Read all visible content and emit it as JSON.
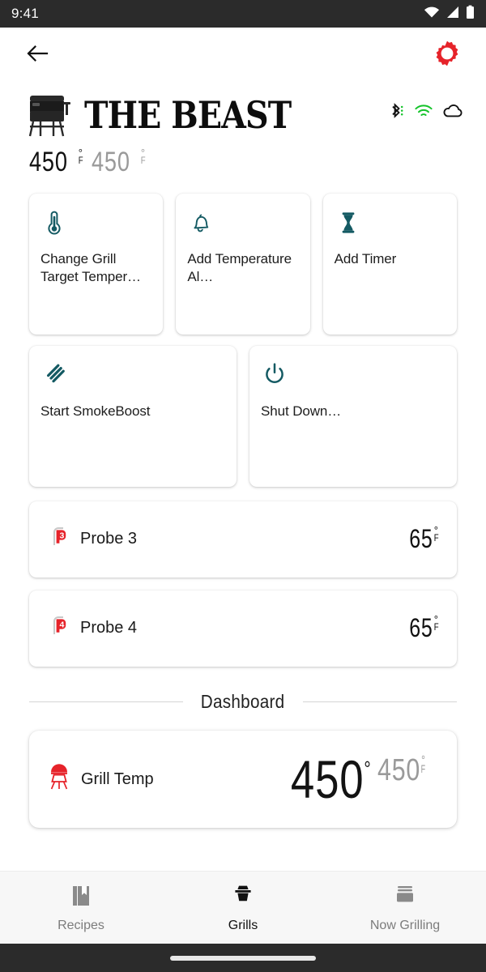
{
  "status_bar": {
    "time": "9:41",
    "icons": [
      "wifi-icon",
      "cellular-signal-icon",
      "battery-icon"
    ]
  },
  "app_bar": {
    "back_icon": "back-arrow-icon",
    "settings_icon": "gear-icon",
    "settings_color": "#e6232a"
  },
  "grill_header": {
    "name": "THE BEAST",
    "grill_image": "pellet-grill-image",
    "connectivity": [
      {
        "name": "bluetooth-icon",
        "color": "#111111"
      },
      {
        "name": "wifi-icon",
        "color": "#14c32a"
      },
      {
        "name": "cloud-icon",
        "color": "#111111"
      }
    ],
    "current_temp": "450",
    "current_unit_deg": "°",
    "current_unit_f": "F",
    "target_temp": "450",
    "target_unit_deg": "°",
    "target_unit_f": "F"
  },
  "action_cards": [
    {
      "icon": "thermometer-icon",
      "label": "Change Grill Target Temper…"
    },
    {
      "icon": "bell-icon",
      "label": "Add Temperature Al…"
    },
    {
      "icon": "hourglass-icon",
      "label": "Add Timer"
    },
    {
      "icon": "smoke-lines-icon",
      "label": "Start SmokeBoost"
    },
    {
      "icon": "power-icon",
      "label": "Shut Down…"
    }
  ],
  "accent_teal": "#145a63",
  "probes": [
    {
      "icon": "probe-badge-icon",
      "badge": "3",
      "label": "Probe 3",
      "temp": "65",
      "deg": "°",
      "unit": "F"
    },
    {
      "icon": "probe-badge-icon",
      "badge": "4",
      "label": "Probe 4",
      "temp": "65",
      "deg": "°",
      "unit": "F"
    }
  ],
  "dashboard": {
    "section_label": "Dashboard",
    "cards": [
      {
        "icon": "kettle-grill-icon",
        "label": "Grill Temp",
        "current_temp": "450",
        "current_deg": "°",
        "current_unit": "F",
        "target_temp": "450",
        "target_deg": "°",
        "target_unit": "F"
      }
    ]
  },
  "bottom_nav": {
    "items": [
      {
        "icon": "recipe-book-icon",
        "label": "Recipes",
        "active": false
      },
      {
        "icon": "grill-icon",
        "label": "Grills",
        "active": true
      },
      {
        "icon": "now-grilling-icon",
        "label": "Now Grilling",
        "active": false
      }
    ]
  }
}
